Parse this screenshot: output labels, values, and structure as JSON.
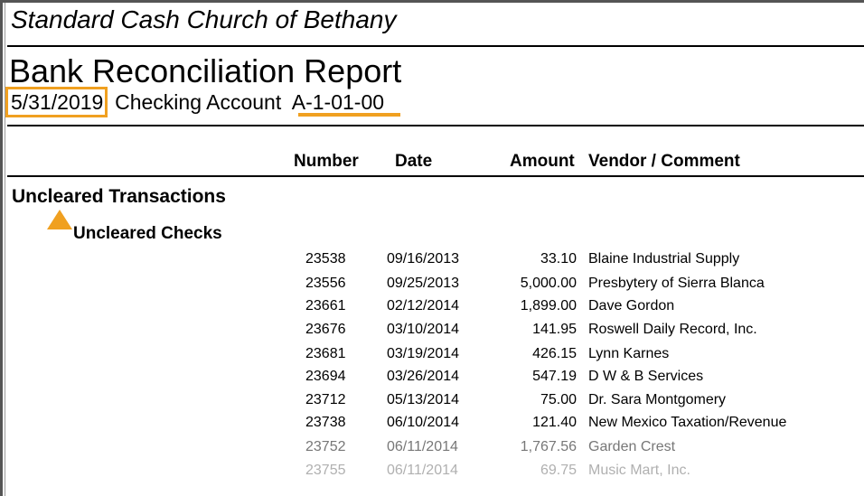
{
  "report": {
    "organization": "Standard Cash Church of Bethany",
    "title": "Bank Reconciliation Report",
    "date": "5/31/2019",
    "account_label": "Checking Account",
    "account_number": "A-1-01-00"
  },
  "columns": {
    "number": "Number",
    "date": "Date",
    "amount": "Amount",
    "vendor": "Vendor / Comment"
  },
  "sections": {
    "uncleared": "Uncleared Transactions",
    "checks": "Uncleared Checks"
  },
  "checks": [
    {
      "number": "23538",
      "date": "09/16/2013",
      "amount": "33.10",
      "vendor": "Blaine Industrial Supply"
    },
    {
      "number": "23556",
      "date": "09/25/2013",
      "amount": "5,000.00",
      "vendor": "Presbytery of Sierra Blanca"
    },
    {
      "number": "23661",
      "date": "02/12/2014",
      "amount": "1,899.00",
      "vendor": "Dave Gordon"
    },
    {
      "number": "23676",
      "date": "03/10/2014",
      "amount": "141.95",
      "vendor": "Roswell Daily Record, Inc."
    },
    {
      "number": "23681",
      "date": "03/19/2014",
      "amount": "426.15",
      "vendor": "Lynn Karnes"
    },
    {
      "number": "23694",
      "date": "03/26/2014",
      "amount": "547.19",
      "vendor": "D W & B Services"
    },
    {
      "number": "23712",
      "date": "05/13/2014",
      "amount": "75.00",
      "vendor": "Dr. Sara Montgomery"
    },
    {
      "number": "23738",
      "date": "06/10/2014",
      "amount": "121.40",
      "vendor": "New Mexico Taxation/Revenue"
    },
    {
      "number": "23752",
      "date": "06/11/2014",
      "amount": "1,767.56",
      "vendor": "Garden Crest"
    },
    {
      "number": "23755",
      "date": "06/11/2014",
      "amount": "69.75",
      "vendor": "Music Mart, Inc."
    }
  ],
  "colors": {
    "highlight": "#f0a020",
    "fade_levels": [
      "#000000",
      "#000000",
      "#000000",
      "#000000",
      "#000000",
      "#000000",
      "#000000",
      "#000000",
      "#777777",
      "#b0b0b0"
    ]
  }
}
